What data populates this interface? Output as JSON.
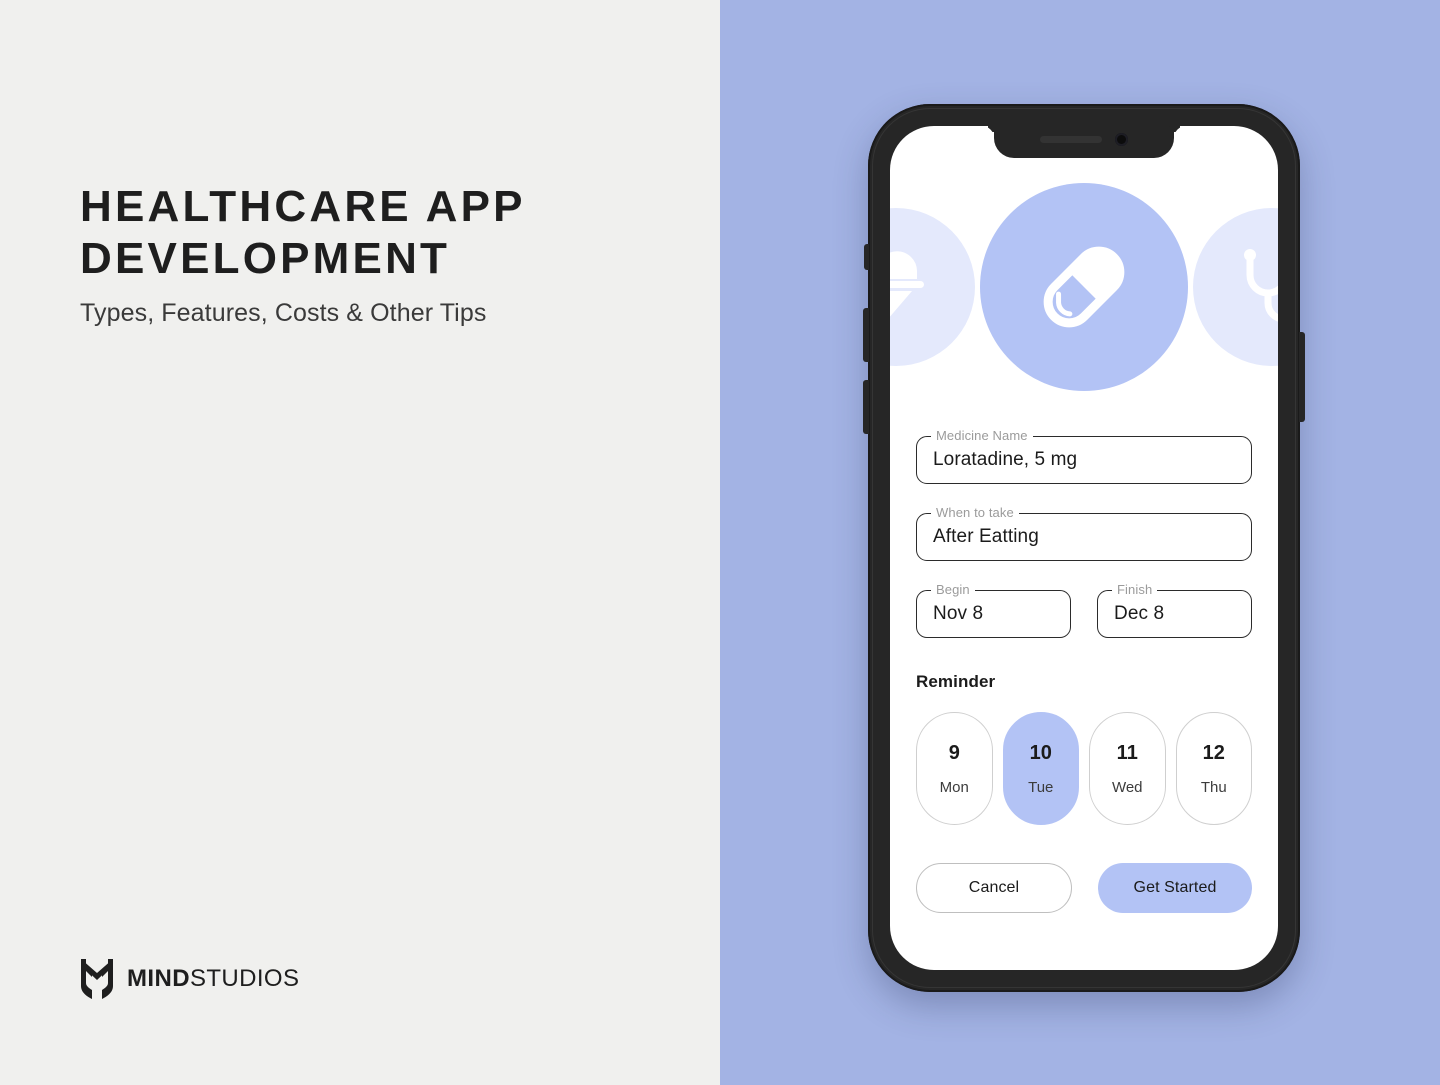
{
  "poster": {
    "headline": "HEALTHCARE APP DEVELOPMENT",
    "subhead": "Types, Features, Costs & Other Tips",
    "background_left": "#F0F0EE",
    "background_right": "#A3B3E4"
  },
  "logo": {
    "brand_bold": "MIND",
    "brand_regular": "STUDIOS",
    "mark": "mind-studios-shield-mark"
  },
  "phone": {
    "notch": {
      "speaker": "earpiece-speaker",
      "camera": "front-camera"
    },
    "hardware_buttons": [
      "silence-switch",
      "volume-up",
      "volume-down",
      "power"
    ]
  },
  "app": {
    "carousel": {
      "left_icon": "syringe-icon",
      "center_icon": "pill-capsule-icon",
      "right_icon": "stethoscope-icon",
      "accent_color": "#B3C3F5",
      "muted_color": "#E4E9FC"
    },
    "fields": [
      {
        "label": "Medicine Name",
        "value": "Loratadine, 5 mg"
      },
      {
        "label": "When to take",
        "value": "After Eatting"
      }
    ],
    "dates": [
      {
        "label": "Begin",
        "value": "Nov 8"
      },
      {
        "label": "Finish",
        "value": "Dec 8"
      }
    ],
    "reminder": {
      "title": "Reminder",
      "days": [
        {
          "num": "9",
          "day": "Mon",
          "selected": false
        },
        {
          "num": "10",
          "day": "Tue",
          "selected": true
        },
        {
          "num": "11",
          "day": "Wed",
          "selected": false
        },
        {
          "num": "12",
          "day": "Thu",
          "selected": false
        }
      ]
    },
    "actions": {
      "cancel_label": "Cancel",
      "primary_label": "Get Started"
    }
  }
}
